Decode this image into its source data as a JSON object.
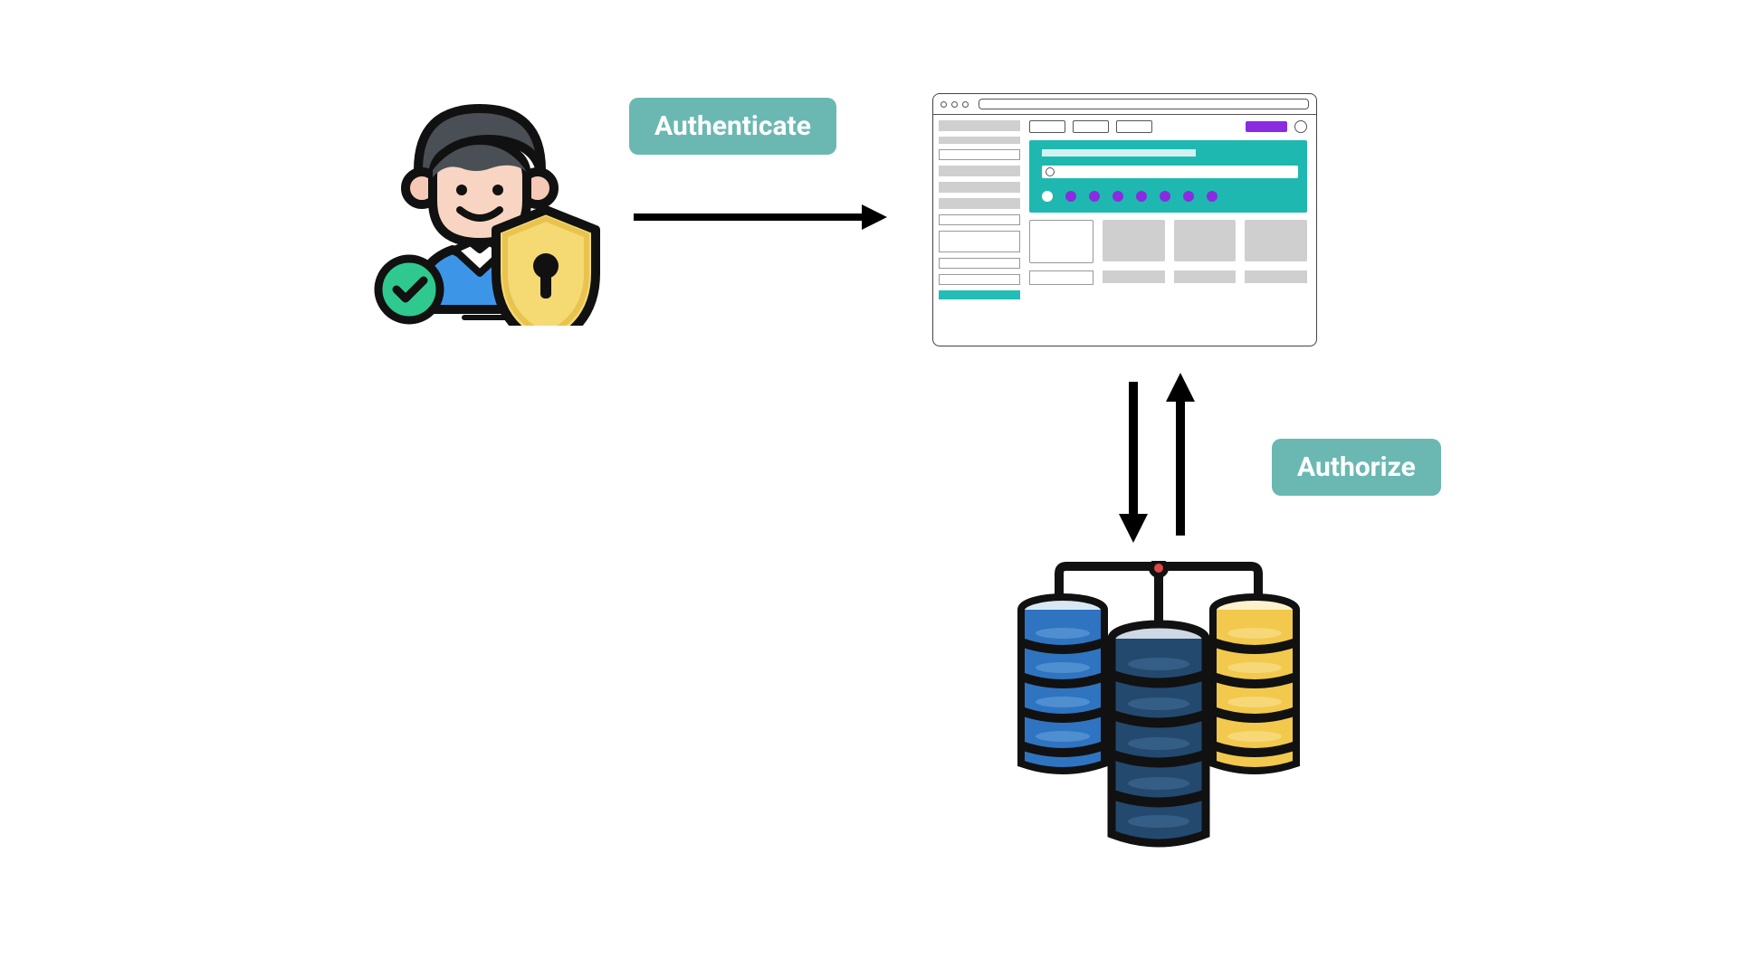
{
  "labels": {
    "authenticate": "Authenticate",
    "authorize": "Authorize"
  },
  "nodes": {
    "user": "Authenticated user with security shield",
    "app": "Web application / browser window",
    "backend": "Backend servers / data stores"
  },
  "edges": [
    {
      "from": "user",
      "to": "app",
      "label_key": "authenticate",
      "direction": "one-way"
    },
    {
      "from": "app",
      "to": "backend",
      "label_key": "authorize",
      "direction": "two-way"
    }
  ],
  "colors": {
    "label_bg": "#6bb8b3",
    "accent_teal": "#1fb8b1",
    "accent_purple": "#8a2be2",
    "server_blue": "#2f74c0",
    "server_navy": "#23496f",
    "server_yellow": "#f2c94c",
    "check_green": "#2fc98f",
    "shield_gold": "#f5d973"
  }
}
